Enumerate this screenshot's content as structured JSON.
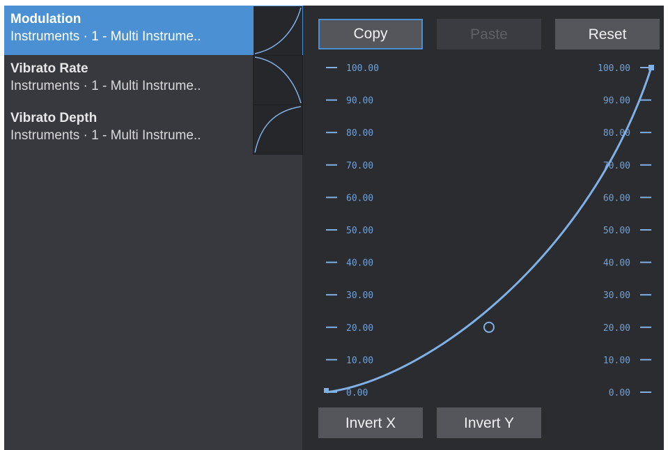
{
  "sidebar": {
    "items": [
      {
        "name": "Modulation",
        "sub": "Instruments · 1 - Multi Instrume..",
        "selected": true
      },
      {
        "name": "Vibrato Rate",
        "sub": "Instruments · 1 - Multi Instrume..",
        "selected": false
      },
      {
        "name": "Vibrato Depth",
        "sub": "Instruments · 1 - Multi Instrume..",
        "selected": false
      }
    ]
  },
  "toolbar": {
    "copy_label": "Copy",
    "paste_label": "Paste",
    "reset_label": "Reset"
  },
  "footer": {
    "invert_x_label": "Invert X",
    "invert_y_label": "Invert Y"
  },
  "scale": {
    "left": [
      "100.00",
      "90.00",
      "80.00",
      "70.00",
      "60.00",
      "50.00",
      "40.00",
      "30.00",
      "20.00",
      "10.00",
      "0.00"
    ],
    "right": [
      "100.00",
      "90.00",
      "80.00",
      "70.00",
      "60.00",
      "50.00",
      "40.00",
      "30.00",
      "20.00",
      "10.00",
      "0.00"
    ]
  },
  "colors": {
    "accent": "#4a90d2",
    "curve": "#7fb0e6",
    "panel_bg": "#2b2c30",
    "sidebar_bg": "#38393e"
  },
  "curve": {
    "min": 0,
    "max": 100,
    "control_point_value": 20
  }
}
